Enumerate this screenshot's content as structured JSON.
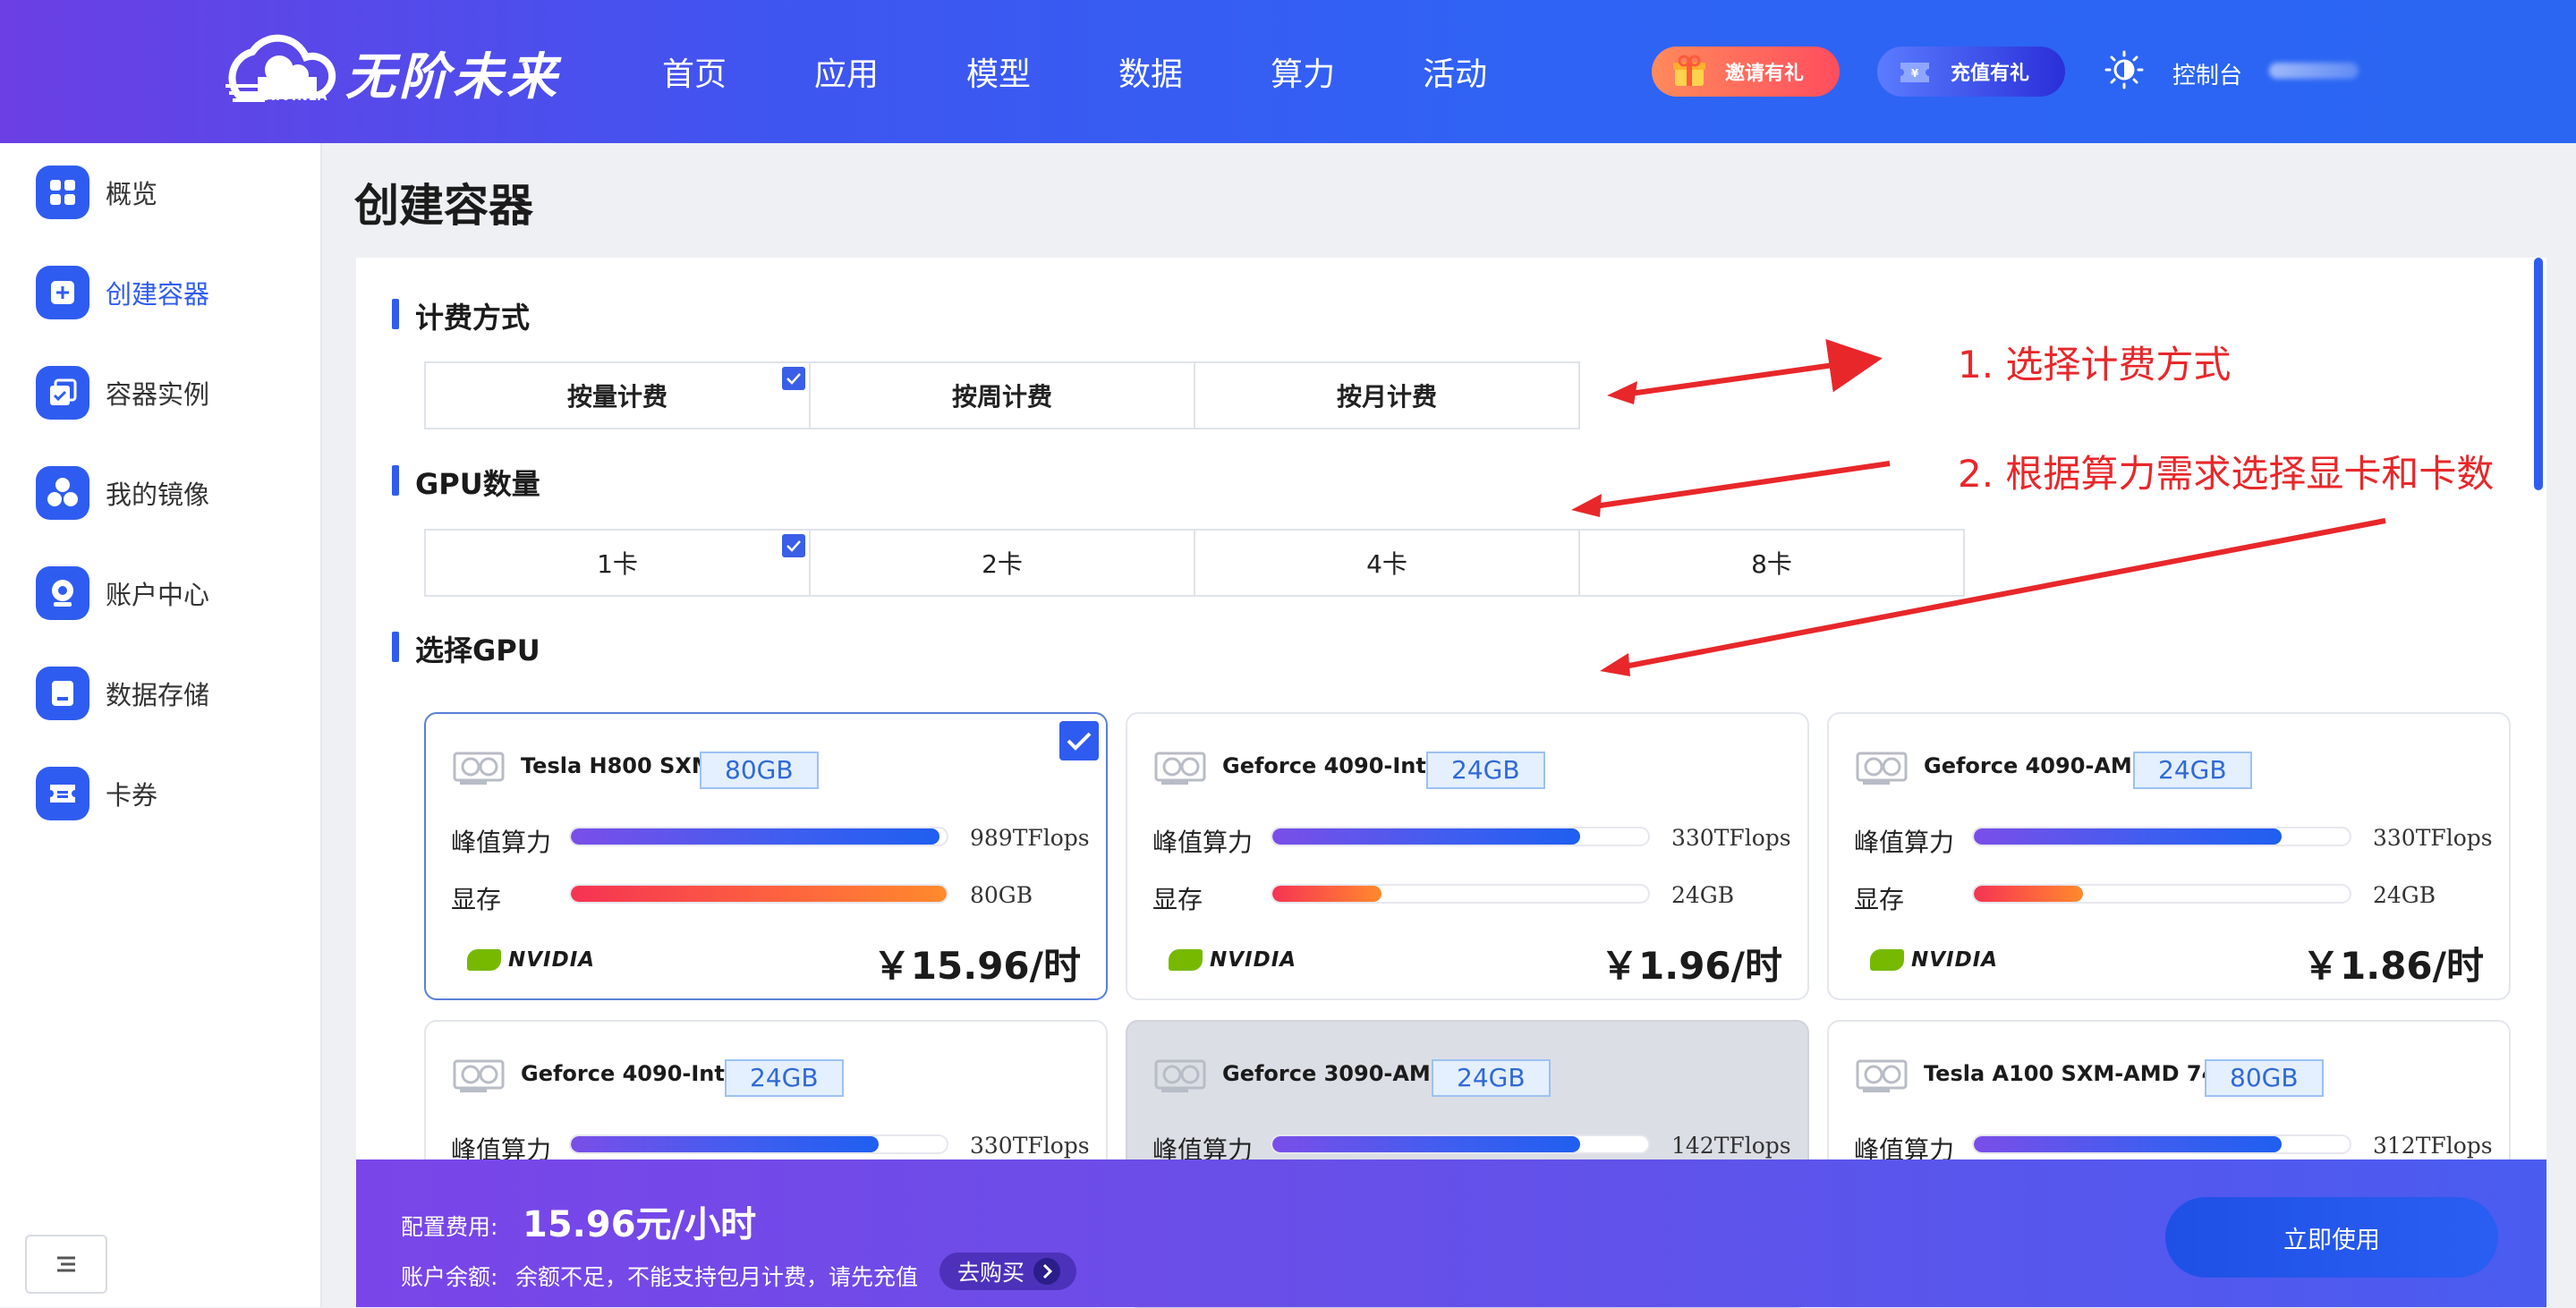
{
  "header": {
    "logo_text": "无阶未来",
    "logo_sub": "AIVINLA",
    "nav": [
      "首页",
      "应用",
      "模型",
      "数据",
      "算力",
      "活动"
    ],
    "invite_label": "邀请有礼",
    "recharge_label": "充值有礼",
    "console_label": "控制台"
  },
  "sidebar": {
    "items": [
      {
        "label": "概览",
        "icon": "grid-icon"
      },
      {
        "label": "创建容器",
        "icon": "plus-icon"
      },
      {
        "label": "容器实例",
        "icon": "instance-icon"
      },
      {
        "label": "我的镜像",
        "icon": "image-icon"
      },
      {
        "label": "账户中心",
        "icon": "account-icon"
      },
      {
        "label": "数据存储",
        "icon": "storage-icon"
      },
      {
        "label": "卡券",
        "icon": "coupon-icon"
      }
    ],
    "active": "创建容器"
  },
  "page": {
    "title": "创建容器",
    "billing": {
      "title": "计费方式",
      "options": [
        "按量计费",
        "按周计费",
        "按月计费"
      ],
      "selected": "按量计费"
    },
    "gpu_count": {
      "title": "GPU数量",
      "options": [
        "1卡",
        "2卡",
        "4卡",
        "8卡"
      ],
      "selected": "1卡"
    },
    "gpu_select": {
      "title": "选择GPU",
      "cards": [
        {
          "name": "Tesla H800 SXM",
          "mem": "80GB",
          "compute_label": "峰值算力",
          "compute": "989TFlops",
          "compute_level": 0.98,
          "memory_label": "显存",
          "memory": "80GB",
          "memory_level": 1.0,
          "brand": "NVIDIA",
          "price": "￥15.96/时",
          "selected": true,
          "disabled": false
        },
        {
          "name": "Geforce 4090-Intel",
          "mem": "24GB",
          "compute_label": "峰值算力",
          "compute": "330TFlops",
          "compute_level": 0.82,
          "memory_label": "显存",
          "memory": "24GB",
          "memory_level": 0.29,
          "brand": "NVIDIA",
          "price": "￥1.96/时",
          "selected": false,
          "disabled": false
        },
        {
          "name": "Geforce 4090-AMD",
          "mem": "24GB",
          "compute_label": "峰值算力",
          "compute": "330TFlops",
          "compute_level": 0.82,
          "memory_label": "显存",
          "memory": "24GB",
          "memory_level": 0.29,
          "brand": "NVIDIA",
          "price": "￥1.86/时",
          "selected": false,
          "disabled": false
        },
        {
          "name": "Geforce 4090-Intel",
          "mem": "24GB",
          "compute_label": "峰值算力",
          "compute": "330TFlops",
          "compute_level": 0.82,
          "selected": false,
          "disabled": false
        },
        {
          "name": "Geforce 3090-AMD",
          "mem": "24GB",
          "compute_label": "峰值算力",
          "compute": "142TFlops",
          "compute_level": 0.82,
          "selected": false,
          "disabled": true
        },
        {
          "name": "Tesla A100 SXM-AMD 7453",
          "mem": "80GB",
          "compute_label": "峰值算力",
          "compute": "312TFlops",
          "compute_level": 0.82,
          "selected": false,
          "disabled": false
        }
      ]
    }
  },
  "annotations": {
    "step1": "1. 选择计费方式",
    "step2": "2. 根据算力需求选择显卡和卡数",
    "color": "#e8272a"
  },
  "footer": {
    "cost_label": "配置费用:",
    "cost_value": "15.96元/小时",
    "balance_label": "账户余额:",
    "balance_msg": "余额不足，不能支持包月计费，请先充值",
    "buy_label": "去购买",
    "use_label": "立即使用"
  },
  "colors": {
    "accent": "#2f5cf0",
    "header_start": "#6b3fe4",
    "header_end": "#2a66f2"
  }
}
